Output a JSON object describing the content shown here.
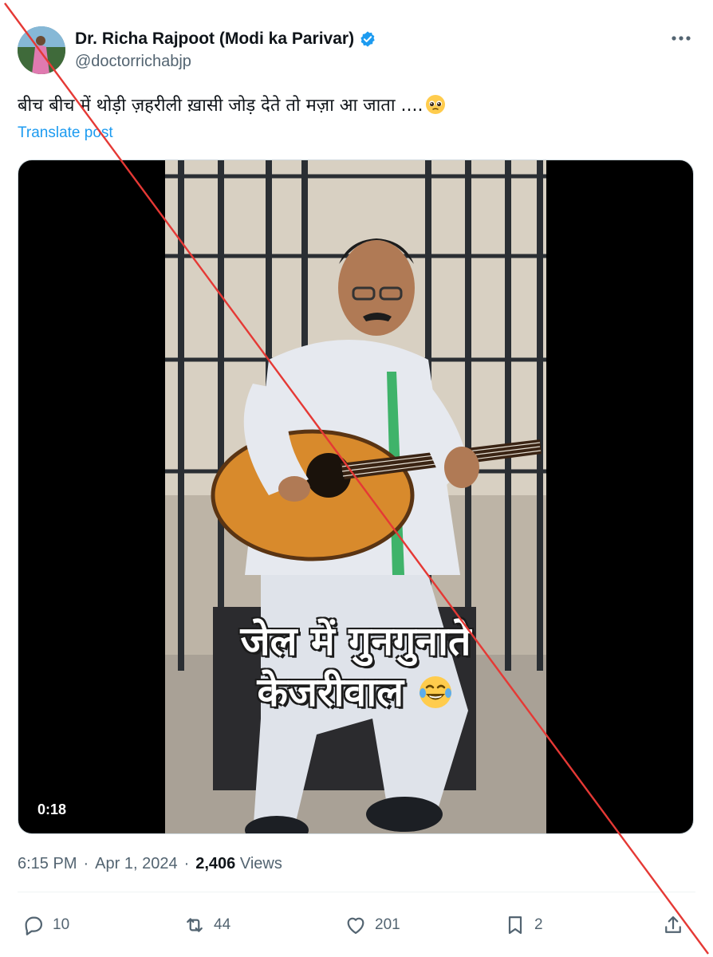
{
  "post": {
    "author_name": "Dr. Richa Rajpoot (Modi ka Parivar)",
    "handle": "@doctorrichabjp",
    "text": "बीच बीच में थोड़ी ज़हरीली ख़ासी जोड़ देते तो मज़ा आ जाता ....",
    "translate_label": "Translate post",
    "verified_color": "#1d9bf0"
  },
  "media": {
    "caption_line1": "जेल में गुनगुनाते",
    "caption_line2": "केजरीवाल",
    "timecode": "0:18"
  },
  "meta": {
    "time": "6:15 PM",
    "separator1": "·",
    "date": "Apr 1, 2024",
    "separator2": "·",
    "views_count": "2,406",
    "views_label": "Views"
  },
  "actions": {
    "replies": "10",
    "reposts": "44",
    "likes": "201",
    "bookmarks": "2"
  },
  "icons": {
    "verified": "verified-badge-icon",
    "more": "more-icon",
    "reply": "reply-icon",
    "repost": "repost-icon",
    "like": "heart-icon",
    "bookmark": "bookmark-icon",
    "share": "share-icon"
  },
  "overlay": {
    "strike_color": "#e53935"
  }
}
